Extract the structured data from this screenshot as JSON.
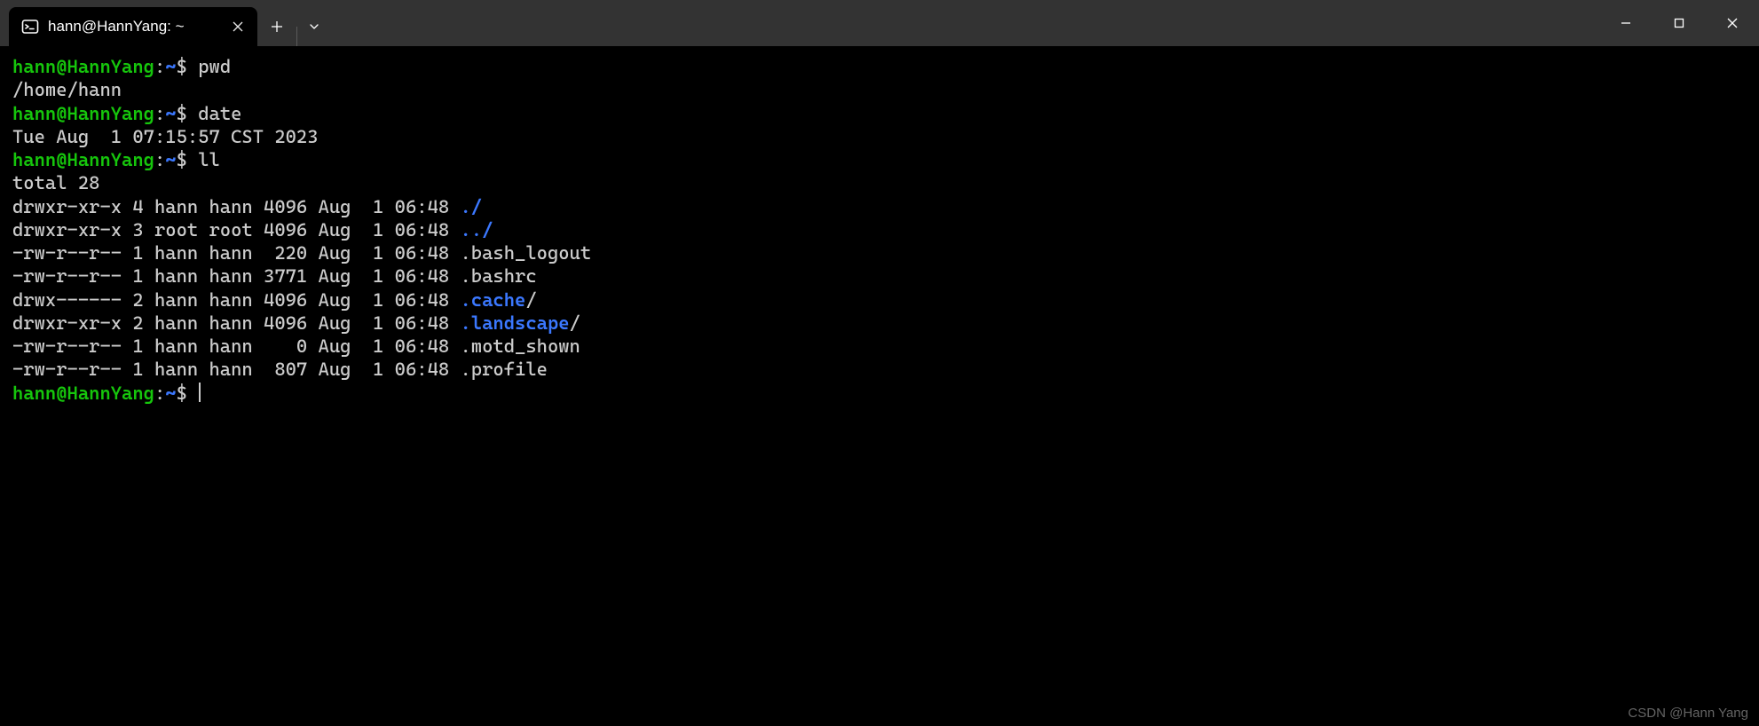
{
  "tab": {
    "title": "hann@HannYang: ~"
  },
  "prompt": {
    "user_host": "hann@HannYang",
    "sep": ":",
    "path": "~",
    "symbol": "$"
  },
  "session": [
    {
      "type": "cmd",
      "text": "pwd"
    },
    {
      "type": "out",
      "text": "/home/hann"
    },
    {
      "type": "cmd",
      "text": "date"
    },
    {
      "type": "out",
      "text": "Tue Aug  1 07:15:57 CST 2023"
    },
    {
      "type": "cmd",
      "text": "ll"
    },
    {
      "type": "out",
      "text": "total 28"
    },
    {
      "type": "ll",
      "meta": "drwxr-xr-x 4 hann hann 4096 Aug  1 06:48 ",
      "name": "./",
      "name_class": "dir"
    },
    {
      "type": "ll",
      "meta": "drwxr-xr-x 3 root root 4096 Aug  1 06:48 ",
      "name": "../",
      "name_class": "dir"
    },
    {
      "type": "ll",
      "meta": "-rw-r--r-- 1 hann hann  220 Aug  1 06:48 ",
      "name": ".bash_logout",
      "name_class": "out"
    },
    {
      "type": "ll",
      "meta": "-rw-r--r-- 1 hann hann 3771 Aug  1 06:48 ",
      "name": ".bashrc",
      "name_class": "out"
    },
    {
      "type": "ll",
      "meta": "drwx------ 2 hann hann 4096 Aug  1 06:48 ",
      "name": ".cache",
      "suffix": "/",
      "name_class": "dir"
    },
    {
      "type": "ll",
      "meta": "drwxr-xr-x 2 hann hann 4096 Aug  1 06:48 ",
      "name": ".landscape",
      "suffix": "/",
      "name_class": "dir"
    },
    {
      "type": "ll",
      "meta": "-rw-r--r-- 1 hann hann    0 Aug  1 06:48 ",
      "name": ".motd_shown",
      "name_class": "out"
    },
    {
      "type": "ll",
      "meta": "-rw-r--r-- 1 hann hann  807 Aug  1 06:48 ",
      "name": ".profile",
      "name_class": "out"
    },
    {
      "type": "cmd",
      "text": "",
      "cursor": true
    }
  ],
  "watermark": "CSDN @Hann Yang"
}
